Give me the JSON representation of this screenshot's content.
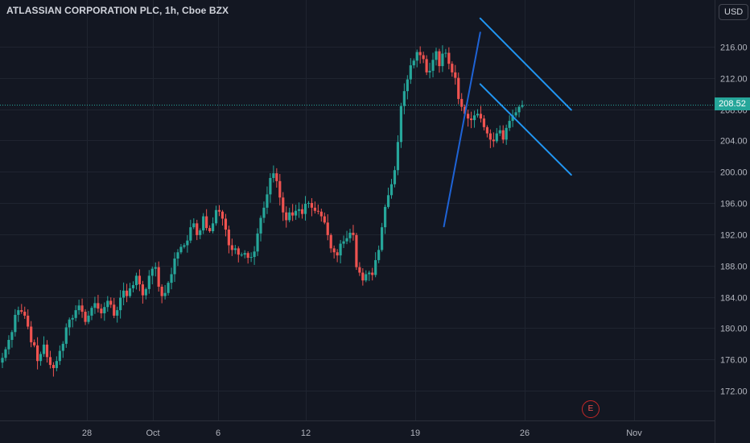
{
  "header": {
    "title": "ATLASSIAN CORPORATION PLC, 1h, Cboe BZX"
  },
  "currency": {
    "label": "USD",
    "icon": "chevron-down-icon"
  },
  "last_price": {
    "label": "208.52",
    "value": 208.52,
    "color": "#26a69a"
  },
  "earnings": {
    "label": "E",
    "color": "#ef5350"
  },
  "colors": {
    "up": "#26a69a",
    "down": "#ef5350",
    "pattern": "#2196f3",
    "pole": "#1e63d6",
    "grid": "#1f2430",
    "background": "#131722"
  },
  "chart_data": {
    "type": "candlestick",
    "symbol": "ATLASSIAN CORPORATION PLC",
    "interval": "1h",
    "exchange": "Cboe BZX",
    "y_axis": {
      "ticks": [
        172,
        176,
        180,
        184,
        188,
        192,
        196,
        200,
        204,
        208,
        212,
        216
      ],
      "ylim": [
        168.8,
        220.8
      ]
    },
    "x_axis": {
      "ticks": [
        "28",
        "Oct",
        "6",
        "12",
        "19",
        "26",
        "Nov"
      ]
    },
    "grid": true,
    "candles_close": [
      176.2,
      177.3,
      178.5,
      179.5,
      181.7,
      182.3,
      182.1,
      181.6,
      180.2,
      178.2,
      177.8,
      175.8,
      176.7,
      177.9,
      176.3,
      175.3,
      174.9,
      175.8,
      177.1,
      178.0,
      180.1,
      181.1,
      181.3,
      182.3,
      182.9,
      182.1,
      180.8,
      181.6,
      182.6,
      183.2,
      182.5,
      181.9,
      182.7,
      183.5,
      183.0,
      181.6,
      182.3,
      183.9,
      184.8,
      184.1,
      185.1,
      185.5,
      186.7,
      185.6,
      184.2,
      185.0,
      186.7,
      187.6,
      187.8,
      185.3,
      184.1,
      184.5,
      185.8,
      186.9,
      188.9,
      189.7,
      190.4,
      190.6,
      191.2,
      192.9,
      193.4,
      191.9,
      192.5,
      194.3,
      192.8,
      192.4,
      193.4,
      195.1,
      194.9,
      194.0,
      192.6,
      190.6,
      190.0,
      190.2,
      189.4,
      189.4,
      189.6,
      189.0,
      189.1,
      189.8,
      192.1,
      194.1,
      195.4,
      197.1,
      199.2,
      199.8,
      198.8,
      196.7,
      194.8,
      193.8,
      194.8,
      194.4,
      195.0,
      195.2,
      194.6,
      195.9,
      196.0,
      195.4,
      195.0,
      194.9,
      194.3,
      193.5,
      191.9,
      190.2,
      189.7,
      189.3,
      190.8,
      191.1,
      191.5,
      192.2,
      191.9,
      187.8,
      187.1,
      186.1,
      186.9,
      187.1,
      186.8,
      188.7,
      190.0,
      192.9,
      195.5,
      197.0,
      198.4,
      200.2,
      203.8,
      208.4,
      210.3,
      211.8,
      213.6,
      214.2,
      215.3,
      214.9,
      214.4,
      212.7,
      212.9,
      214.3,
      215.4,
      213.5,
      215.1,
      215.2,
      213.8,
      212.7,
      212.0,
      209.3,
      208.3,
      207.4,
      206.8,
      206.6,
      207.2,
      207.4,
      206.8,
      205.7,
      204.9,
      204.1,
      203.9,
      204.9,
      205.3,
      204.1,
      205.6,
      206.5,
      207.2,
      207.6,
      208.3,
      208.5
    ],
    "last_price": 208.52,
    "annotations": [
      {
        "type": "flagpole",
        "from": {
          "x": "Oct 17",
          "y": 193.0
        },
        "to": {
          "x": "Oct 19",
          "y": 217.8
        }
      },
      {
        "type": "channel_upper",
        "from": {
          "x": "Oct 19",
          "y": 219.6
        },
        "to": {
          "x": "Oct 24",
          "y": 207.9
        }
      },
      {
        "type": "channel_lower",
        "from": {
          "x": "Oct 19",
          "y": 211.2
        },
        "to": {
          "x": "Oct 24",
          "y": 199.6
        }
      },
      {
        "type": "earnings_marker",
        "label": "E",
        "x": "Oct 31"
      }
    ]
  }
}
